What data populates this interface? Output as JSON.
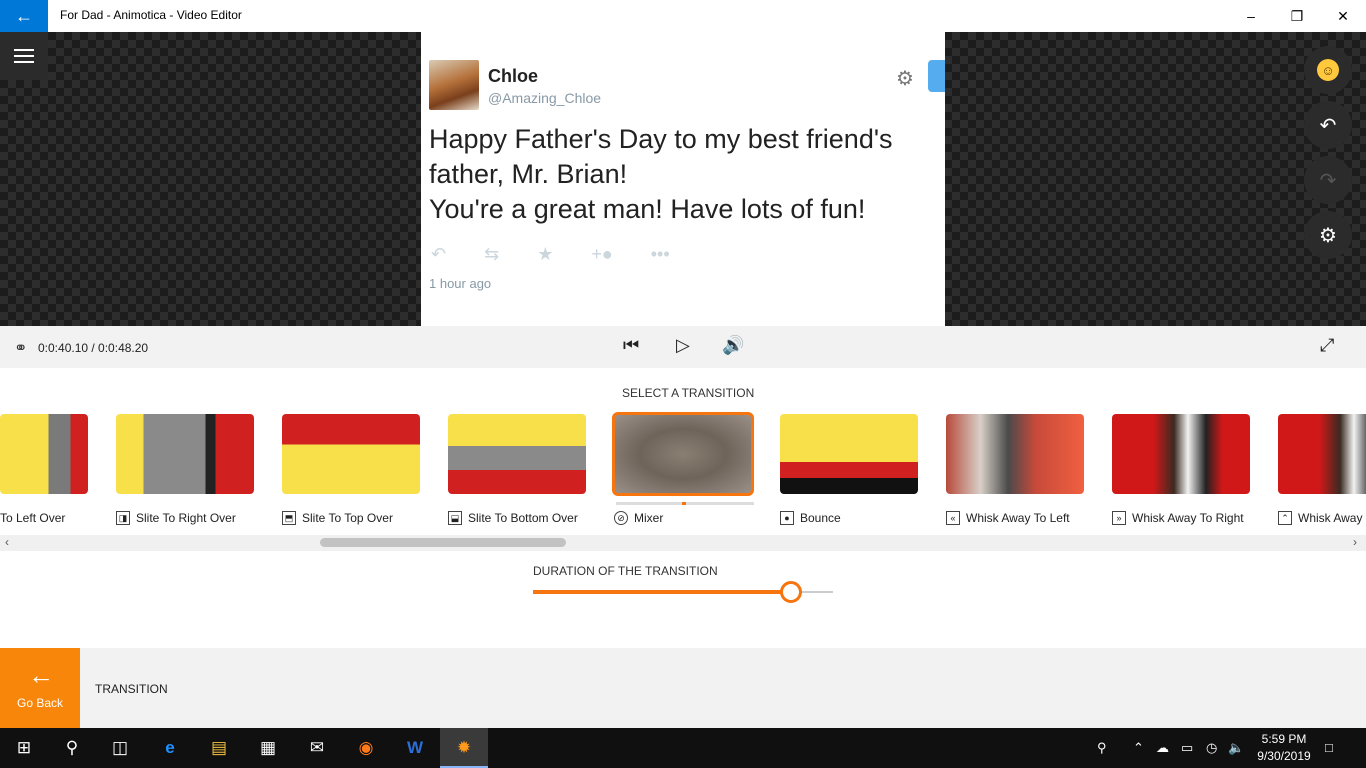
{
  "window": {
    "title": "For Dad - Animotica - Video Editor",
    "back_icon": "arrow-left-icon"
  },
  "tweet": {
    "name": "Chloe",
    "handle": "@Amazing_Chloe",
    "text_line1": "Happy Father's Day to my best friend's",
    "text_line2": "father, Mr. Brian!",
    "text_line3": "You're a great man! Have lots of fun!",
    "time": "1 hour ago"
  },
  "playback": {
    "time": "0:0:40.10 / 0:0:48.20"
  },
  "transitions": {
    "section_title": "SELECT A TRANSITION",
    "selected_index": 4,
    "items": [
      {
        "label": "To Left Over",
        "icon": "◧"
      },
      {
        "label": "Slite To Right Over",
        "icon": "◨"
      },
      {
        "label": "Slite To Top Over",
        "icon": "⬒"
      },
      {
        "label": "Slite To Bottom Over",
        "icon": "⬓"
      },
      {
        "label": "Mixer",
        "icon": "⊘"
      },
      {
        "label": "Bounce",
        "icon": "●"
      },
      {
        "label": "Whisk Away To Left",
        "icon": "«"
      },
      {
        "label": "Whisk Away To Right",
        "icon": "»"
      },
      {
        "label": "Whisk Away",
        "icon": "⌃"
      }
    ]
  },
  "duration": {
    "title": "DURATION OF THE TRANSITION",
    "value_fraction": 0.86
  },
  "bottom": {
    "go_back": "Go Back",
    "section": "TRANSITION"
  },
  "taskbar": {
    "time": "5:59 PM",
    "date": "9/30/2019"
  },
  "colors": {
    "accent": "#f7750f",
    "titlebar_back": "#0078d7"
  }
}
